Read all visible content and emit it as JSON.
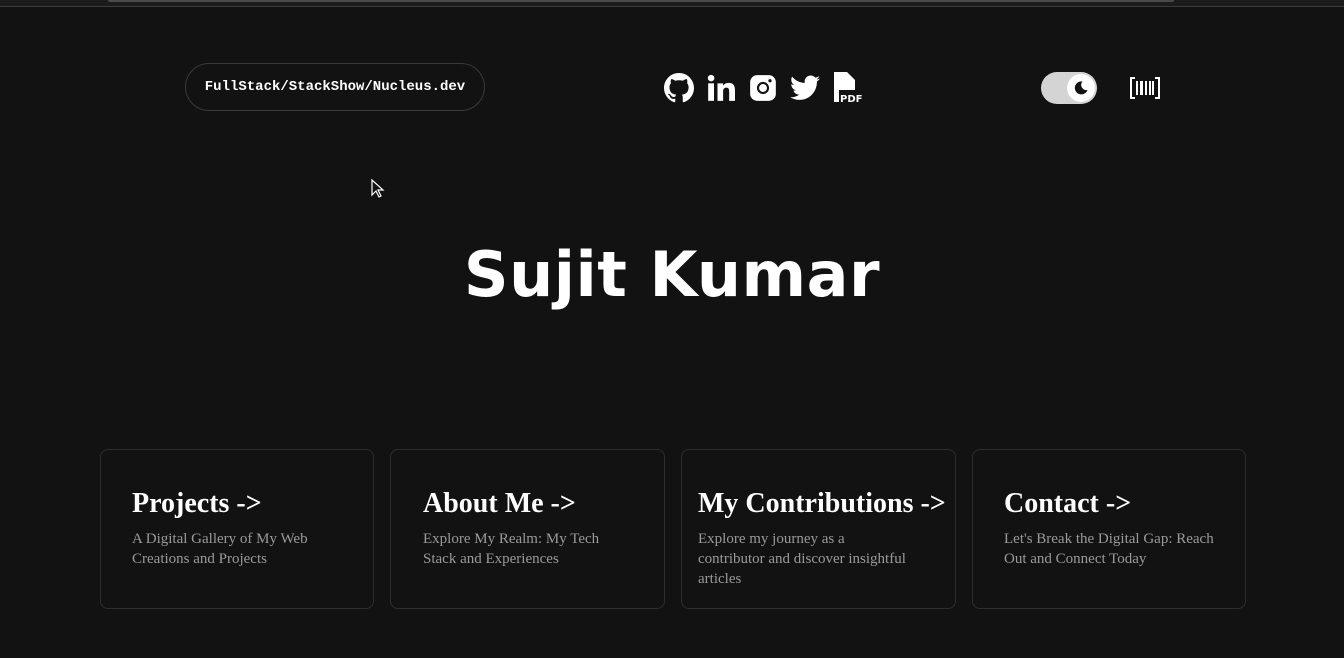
{
  "header": {
    "brand": "FullStack/StackShow/Nucleus.dev",
    "socials": [
      {
        "icon": "github-icon"
      },
      {
        "icon": "linkedin-icon"
      },
      {
        "icon": "instagram-icon"
      },
      {
        "icon": "twitter-icon"
      },
      {
        "icon": "pdf-resume-icon"
      }
    ],
    "theme_toggle": {
      "state": "dark",
      "icon": "moon-icon"
    },
    "menu_icon": "barcode-icon"
  },
  "hero": {
    "name": "Sujit Kumar"
  },
  "cards": [
    {
      "title": "Projects ->",
      "description": "A Digital Gallery of My Web Creations and Projects"
    },
    {
      "title": "About Me ->",
      "description": "Explore My Realm: My Tech Stack and Experiences"
    },
    {
      "title": "My Contributions ->",
      "description": "Explore my journey as a contributor and discover insightful articles"
    },
    {
      "title": "Contact ->",
      "description": "Let's Break the Digital Gap: Reach Out and Connect Today"
    }
  ],
  "colors": {
    "background": "#121212",
    "text": "#ffffff",
    "muted": "#9a9a9a",
    "border": "#2e2e2e"
  }
}
